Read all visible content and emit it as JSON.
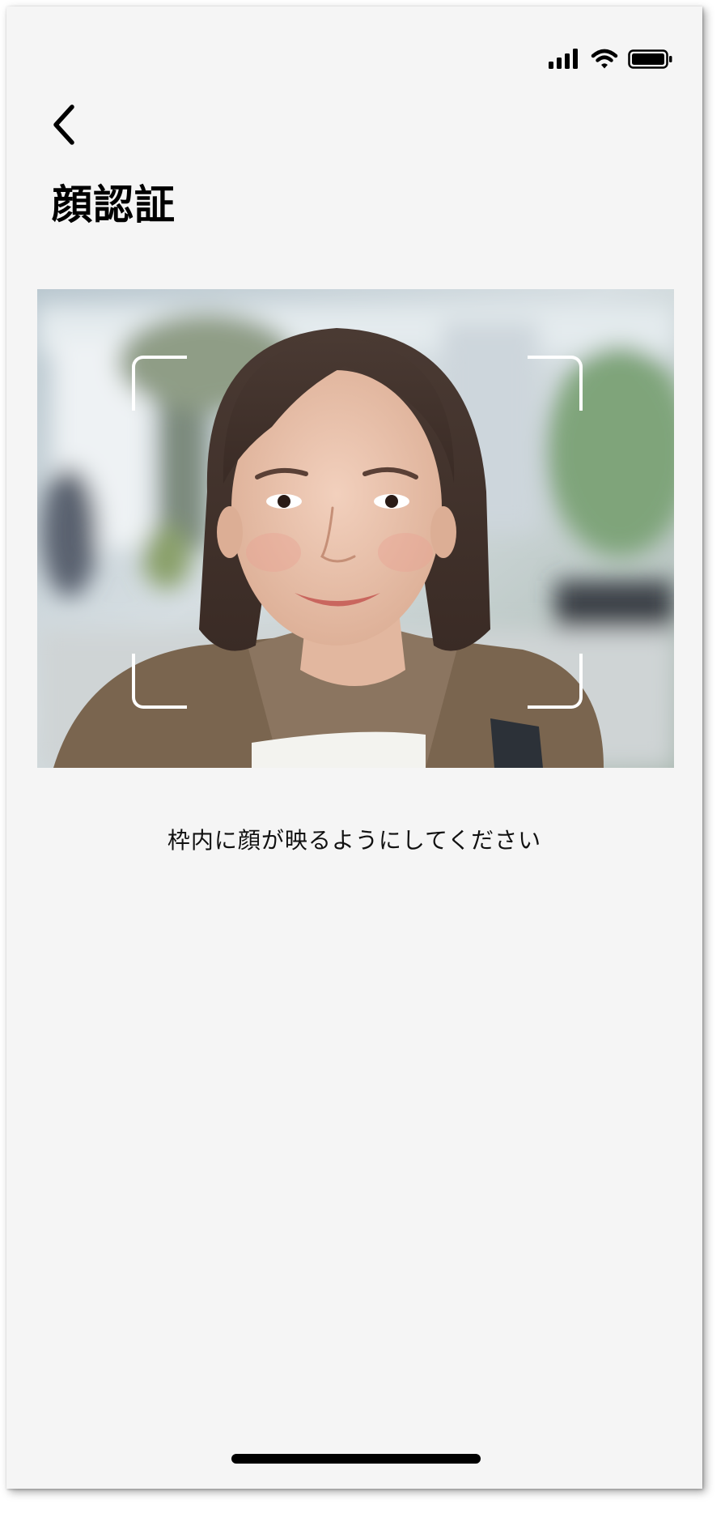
{
  "status_bar": {
    "icons": [
      "cellular-signal-icon",
      "wifi-icon",
      "battery-icon"
    ]
  },
  "header": {
    "back_icon": "chevron-left-icon",
    "title": "顔認証"
  },
  "camera": {
    "frame_color": "#ffffff"
  },
  "instruction": "枠内に顔が映るようにしてください",
  "colors": {
    "background": "#f5f5f5",
    "text": "#000000"
  }
}
